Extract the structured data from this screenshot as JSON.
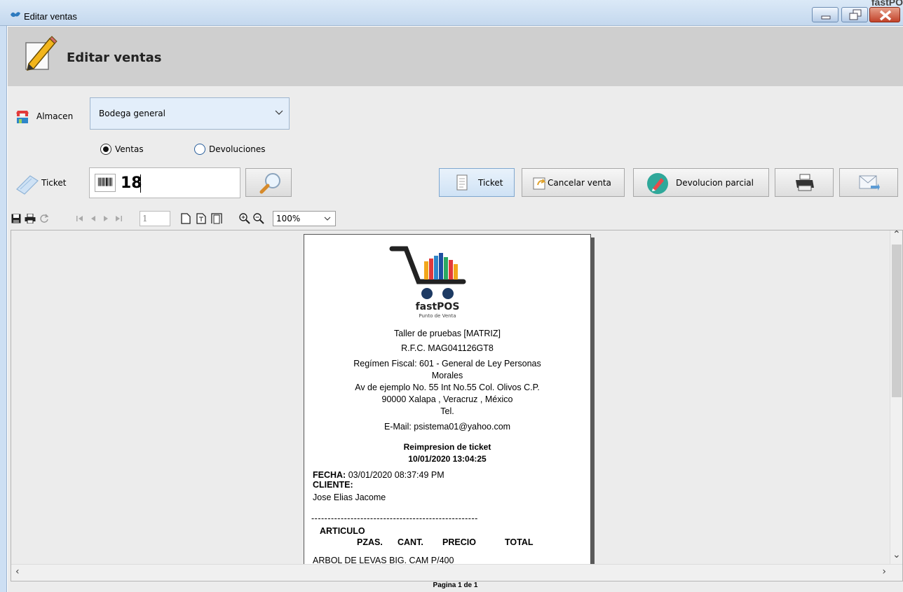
{
  "window": {
    "title": "Editar ventas",
    "corner_text": "fastPO"
  },
  "header": {
    "title": "Editar ventas"
  },
  "almacen": {
    "label": "Almacen",
    "selected": "Bodega general"
  },
  "mode_radios": {
    "ventas_label": "Ventas",
    "devoluciones_label": "Devoluciones",
    "selected": "Ventas"
  },
  "ticket": {
    "label": "Ticket",
    "value": "18"
  },
  "actions": {
    "ticket_label": "Ticket",
    "cancelar_label": "Cancelar venta",
    "devolucion_label": "Devolucion parcial"
  },
  "report_toolbar": {
    "page_value": "1",
    "zoom_value": "100%"
  },
  "receipt": {
    "brand": "fastPOS",
    "brand_sub": "Punto de Venta",
    "business": "Taller de pruebas [MATRIZ]",
    "rfc": "R.F.C. MAG041126GT8",
    "regimen_line1": "Regímen Fiscal: 601 - General de Ley Personas",
    "regimen_line2": "Morales",
    "address_line1": "Av de ejemplo  No. 55 Int No.55  Col. Olivos  C.P.",
    "address_line2": "90000 Xalapa , Veracruz , México",
    "tel": "Tel.",
    "email": "E-Mail: psistema01@yahoo.com",
    "reprint_title": "Reimpresion de ticket",
    "reprint_datetime": "10/01/2020 13:04:25",
    "fecha_label": "FECHA:",
    "fecha_value": "03/01/2020 08:37:49 PM",
    "cliente_label": "CLIENTE:",
    "cliente_name": "Jose Elias Jacome",
    "separator": "---------------------------------------------------",
    "col_articulo": "ARTICULO",
    "col_pzas": "PZAS.",
    "col_cant": "CANT.",
    "col_precio": "PRECIO",
    "col_total": "TOTAL",
    "first_item": "ARBOL DE LEVAS BIG. CAM P/400"
  },
  "status": {
    "page_info": "Pagina 1 de 1"
  },
  "colors": {
    "header_band": "#cfcfcf",
    "content_bg": "#ececec",
    "select_bg": "#e3eefa",
    "close_red": "#c2432a"
  }
}
